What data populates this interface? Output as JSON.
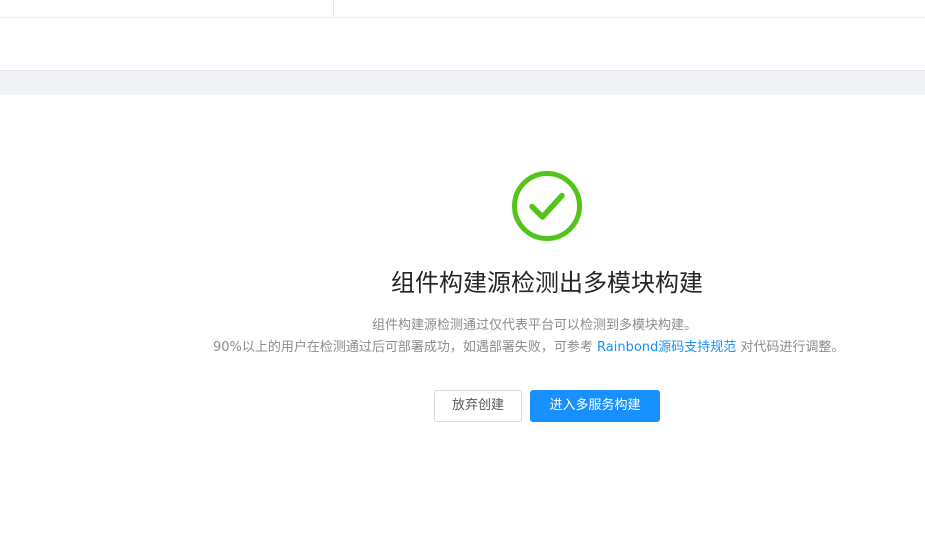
{
  "result": {
    "status": "success",
    "status_color": "#52c41a",
    "icon": "check-circle-icon",
    "title": "组件构建源检测出多模块构建",
    "description_line1": "组件构建源检测通过仅代表平台可以检测到多模块构建。",
    "description_line2_prefix": "90%以上的用户在检测通过后可部署成功，如遇部署失败，可参考 ",
    "description_link": "Rainbond源码支持规范",
    "description_line2_suffix": " 对代码进行调整。"
  },
  "actions": {
    "abandon_label": "放弃创建",
    "enter_label": "进入多服务构建"
  },
  "colors": {
    "primary": "#1890ff",
    "success": "#52c41a"
  }
}
